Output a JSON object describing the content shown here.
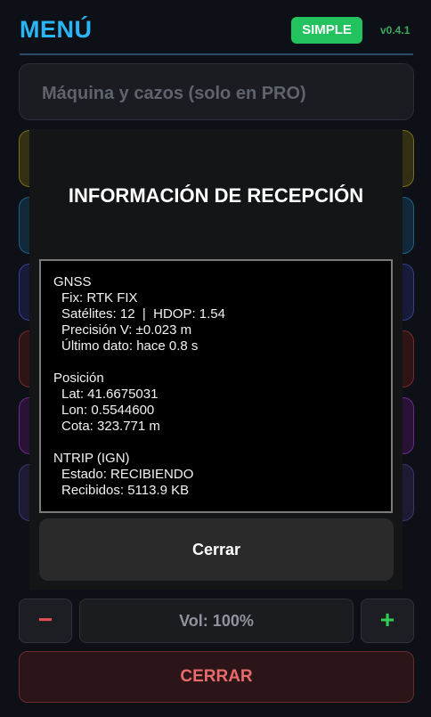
{
  "header": {
    "title": "MENÚ",
    "mode_button": "SIMPLE",
    "version": "v0.4.1"
  },
  "menu": {
    "machine_label": "Máquina y cazos   (solo en PRO)"
  },
  "volume": {
    "minus": "−",
    "plus": "+",
    "display": "Vol: 100%"
  },
  "close_main": "CERRAR",
  "modal": {
    "title": "INFORMACIÓN DE RECEPCIÓN",
    "gnss": {
      "heading": "GNSS",
      "fix": "Fix: RTK FIX",
      "sats": "Satélites: 12  |  HDOP: 1.54",
      "precision": "Precisión V: ±0.023 m",
      "last": "Último dato: hace 0.8 s"
    },
    "position": {
      "heading": "Posición",
      "lat": "Lat: 41.6675031",
      "lon": "Lon: 0.5544600",
      "cota": "Cota: 323.771 m"
    },
    "ntrip": {
      "heading": "NTRIP (IGN)",
      "state": "Estado: RECIBIENDO",
      "received": "Recibidos: 5113.9 KB"
    },
    "close_label": "Cerrar"
  },
  "colors": {
    "accent": "#29b6f6",
    "mode_green": "#22c35e",
    "danger": "#e86a6a"
  }
}
